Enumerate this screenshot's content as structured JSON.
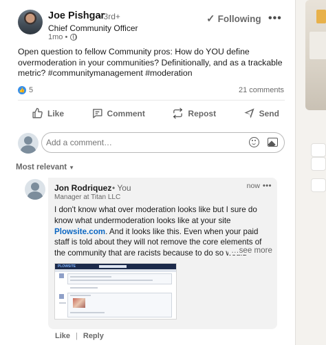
{
  "post": {
    "author": {
      "name": "Joe Pishgar",
      "degree": "• 3rd+",
      "title": "Chief Community Officer",
      "time": "1mo •"
    },
    "follow_label": "Following",
    "more_label": "•••",
    "text": "Open question to fellow Community pros: How do YOU define overmoderation in your communities? Definitionally, and as a trackable metric? #communitymanagement #moderation",
    "reaction_count": "5",
    "comments_count": "21 comments"
  },
  "actions": {
    "like": "Like",
    "comment": "Comment",
    "repost": "Repost",
    "send": "Send"
  },
  "comment_box": {
    "placeholder": "Add a comment…"
  },
  "sort": {
    "label": "Most relevant"
  },
  "comment": {
    "author": "Jon Rodriquez",
    "you": "• You",
    "headline": "Manager at Titan LLC",
    "time": "now",
    "more_label": "•••",
    "text_before_link": "I don't know what over moderation looks like but I sure do know what undermoderation looks like at your site ",
    "link": "Plowsite.com",
    "text_after_link": ". And it looks like this. Even when your paid staff is told about they will not remove the core elements of the community that are racists because to do so would remove the entire",
    "see_more": "…see more",
    "thumbnail_logo": "PLOWSITE",
    "reply_actions": {
      "like": "Like",
      "separator": "|",
      "reply": "Reply"
    }
  },
  "colors": {
    "accent": "#0a66c2",
    "reaction_blue": "#378fe9",
    "page_bg": "#f4f2ee"
  },
  "icons": [
    "globe-icon",
    "check-icon",
    "more-icon",
    "like-icon",
    "comment-icon",
    "repost-icon",
    "send-icon",
    "emoji-icon",
    "image-icon",
    "caret-down-icon"
  ]
}
